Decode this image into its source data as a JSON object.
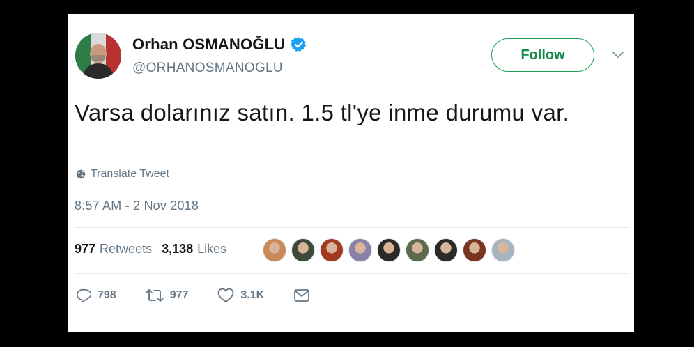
{
  "author": {
    "display_name": "Orhan OSMANOĞLU",
    "handle": "@ORHANOSMANOGLU",
    "verified": true
  },
  "follow_label": "Follow",
  "tweet": {
    "text": "Varsa dolarınız satın. 1.5 tl'ye inme durumu var.",
    "translate_label": "Translate Tweet",
    "timestamp": "8:57 AM - 2 Nov 2018"
  },
  "stats": {
    "retweets_count": "977",
    "retweets_label": "Retweets",
    "likes_count": "3,138",
    "likes_label": "Likes"
  },
  "liker_avatars": [
    {
      "color": "#c98a5a"
    },
    {
      "color": "#3d4a3a"
    },
    {
      "color": "#a23a22"
    },
    {
      "color": "#8a82a6"
    },
    {
      "color": "#2a2a2a"
    },
    {
      "color": "#5a6a4a"
    },
    {
      "color": "#2b2a26"
    },
    {
      "color": "#7a3422"
    },
    {
      "color": "#a9b4c1"
    }
  ],
  "actions": {
    "replies": "798",
    "retweets": "977",
    "likes": "3.1K"
  },
  "colors": {
    "follow_border": "#1a9e58",
    "verified_blue": "#1da1f2",
    "secondary_text": "#657786",
    "primary_text": "#14171a"
  },
  "icons": {
    "reply": "reply-icon",
    "retweet": "retweet-icon",
    "like": "heart-icon",
    "message": "envelope-icon",
    "translate": "globe-icon",
    "verified": "verified-badge-icon",
    "caret": "chevron-down-icon"
  }
}
